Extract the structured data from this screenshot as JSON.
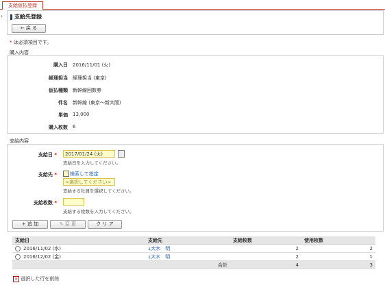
{
  "tab": {
    "label": "支給仮払登録"
  },
  "page": {
    "title": "支給先登録",
    "back_label": "← 戻 る"
  },
  "required_note": {
    "star": "*",
    "text": "は必須項目です。"
  },
  "purchase": {
    "section_label": "購入内容",
    "rows": [
      {
        "label": "購入日",
        "value": "2016/11/01 (火)"
      },
      {
        "label": "経理担当",
        "value": "経理担当 (東京)"
      },
      {
        "label": "仮払種類",
        "value": "新幹線回数券"
      },
      {
        "label": "件名",
        "value": "新幹線 (東京～新大阪)"
      },
      {
        "label": "単価",
        "value": "13,000"
      },
      {
        "label": "購入枚数",
        "value": "6"
      }
    ]
  },
  "payment": {
    "section_label": "支給内容",
    "date": {
      "label": "支給日",
      "value": "2017/01/24 (火)",
      "hint": "支給日を入力してください。"
    },
    "recipient": {
      "label": "支給先",
      "search_link": "検索して指定",
      "placeholder": "<選択してください>",
      "hint": "支給する社員を選択してください。"
    },
    "count": {
      "label": "支給枚数",
      "value": "",
      "hint": "支給する枚数を入力してください。"
    },
    "buttons": {
      "add": "+ 追 加",
      "change": "✎ 変 更",
      "clear": "ク リ ア"
    }
  },
  "table": {
    "headers": [
      "支給日",
      "支給先",
      "支給枚数",
      "使用枚数"
    ],
    "rows": [
      {
        "date": "2016/11/02 (水)",
        "person": "大木　明",
        "count": "2",
        "used": "2"
      },
      {
        "date": "2016/12/02 (金)",
        "person": "大木　明",
        "count": "2",
        "used": "1"
      }
    ],
    "total_label": "合計",
    "total_count": "4",
    "total_used": "3"
  },
  "footer": {
    "delete_label": "選択した行を削除"
  }
}
